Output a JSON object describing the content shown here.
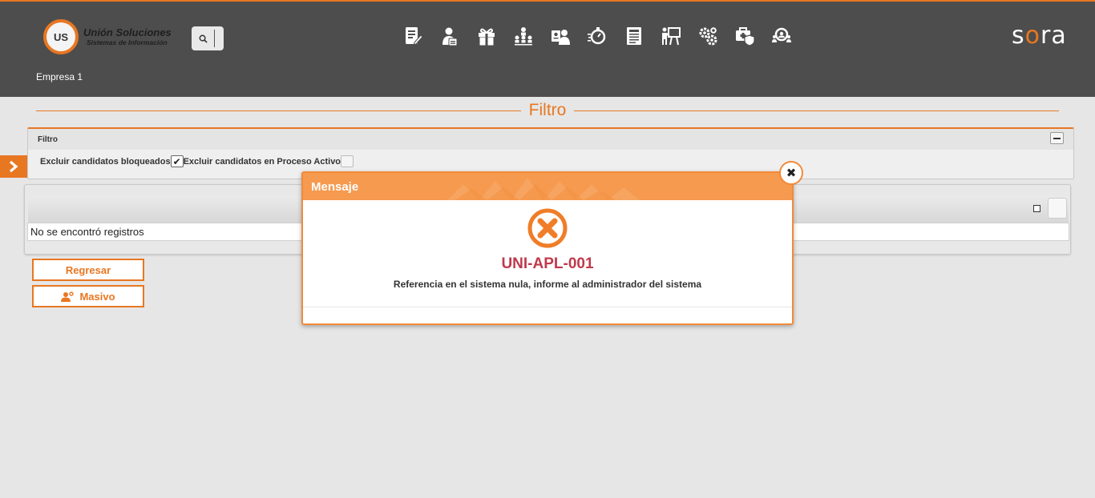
{
  "header": {
    "logo_badge": "US",
    "logo_name": "Unión Soluciones",
    "logo_sub": "Sistemas de Información",
    "brand_prefix": "s",
    "brand_o": "o",
    "brand_suffix": "ra",
    "company": "Empresa 1",
    "nav_icons": [
      "document-edit-icon",
      "user-document-icon",
      "gift-icon",
      "org-chart-icon",
      "user-badge-icon",
      "stopwatch-icon",
      "form-document-icon",
      "presentation-icon",
      "gears-icon",
      "medical-kit-icon",
      "group-search-icon"
    ],
    "accent_color": "#e87722"
  },
  "section": {
    "title": "Filtro"
  },
  "filter": {
    "panel_title": "Filtro",
    "exclude_blocked_label": "Excluir candidatos bloqueados",
    "exclude_blocked_checked": true,
    "exclude_active_label": "Excluir candidatos en Proceso Activo",
    "exclude_active_checked": false
  },
  "results": {
    "empty_text": "No se encontró registros"
  },
  "actions": {
    "back_label": "Regresar",
    "bulk_label": "Masivo"
  },
  "modal": {
    "title": "Mensaje",
    "code": "UNI-APL-001",
    "message": "Referencia en el sistema nula, informe al administrador del sistema",
    "close_glyph": "✖",
    "error_color": "#c0394b"
  }
}
